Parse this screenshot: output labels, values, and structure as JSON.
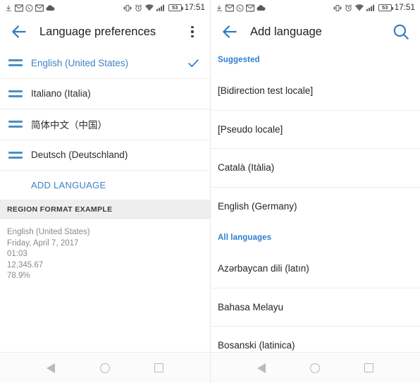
{
  "status_bar": {
    "time": "17:51",
    "battery_level": "53",
    "left_icons": [
      "download-icon",
      "mail-icon",
      "whatsapp-icon",
      "mail-icon",
      "cloud-icon"
    ],
    "right_icons": [
      "vibrate-icon",
      "alarm-icon",
      "wifi-icon",
      "signal-icon",
      "battery-icon"
    ]
  },
  "left_screen": {
    "title": "Language preferences",
    "back_icon": "back-arrow-icon",
    "overflow_icon": "overflow-menu-icon",
    "languages": [
      {
        "name": "English (United States)",
        "selected": true
      },
      {
        "name": "Italiano (Italia)",
        "selected": false
      },
      {
        "name": "简体中文（中国）",
        "selected": false
      },
      {
        "name": "Deutsch (Deutschland)",
        "selected": false
      }
    ],
    "add_language_label": "ADD LANGUAGE",
    "region_section_header": "REGION FORMAT EXAMPLE",
    "region_format_example": [
      "English (United States)",
      "Friday, April 7, 2017",
      "01:03",
      "12,345.67",
      "78.9%"
    ]
  },
  "right_screen": {
    "title": "Add language",
    "back_icon": "back-arrow-icon",
    "search_icon": "search-icon",
    "groups": [
      {
        "header": "Suggested",
        "items": [
          "[Bidirection test locale]",
          "[Pseudo locale]",
          "Català (Itàlia)",
          "English (Germany)"
        ]
      },
      {
        "header": "All languages",
        "items": [
          "Azərbaycan dili (latın)",
          "Bahasa Melayu",
          "Bosanski (latinica)"
        ]
      }
    ]
  },
  "nav_bar": {
    "back_label": "back-nav",
    "home_label": "home-nav",
    "recents_label": "recents-nav"
  },
  "colors": {
    "accent_blue": "#3b83c4",
    "group_blue": "#2f7fd0",
    "handle_blue": "#4a90c4",
    "text_primary": "#242424",
    "text_muted": "#8a8a8a",
    "band_gray": "#eeeeee"
  }
}
